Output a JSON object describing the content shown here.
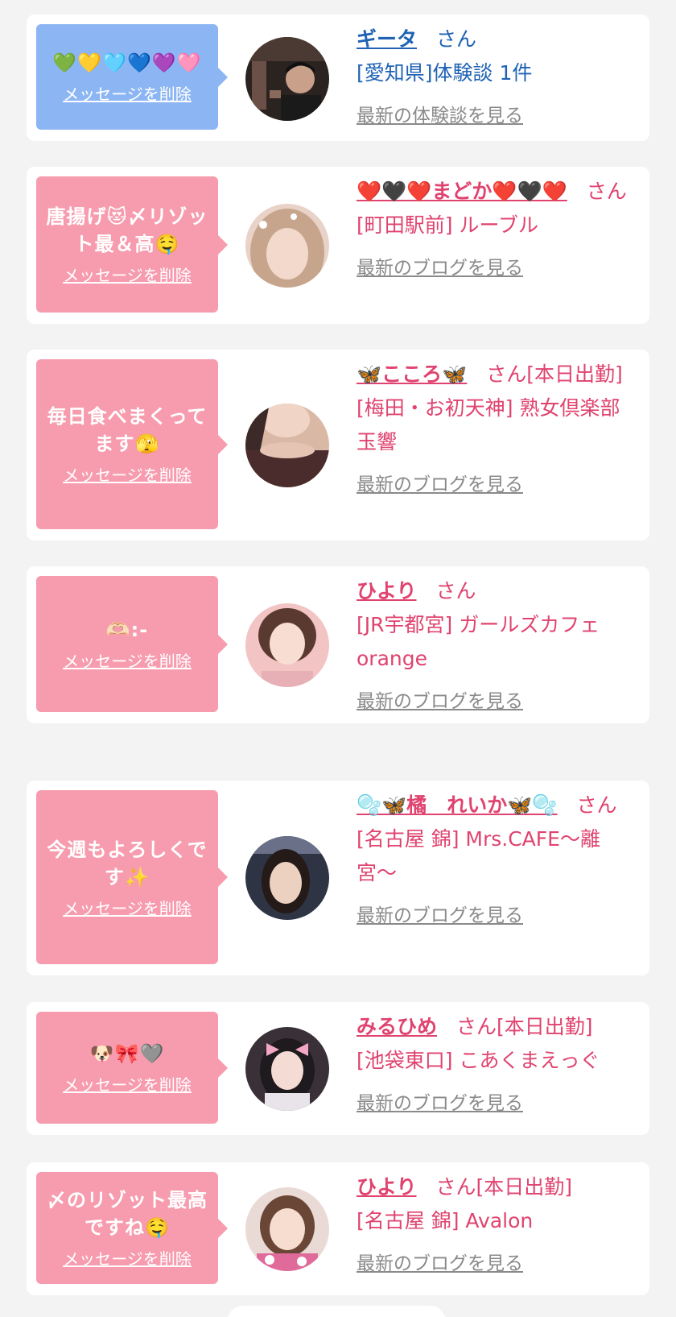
{
  "delete_label": "メッセージを削除",
  "san_label": "さん",
  "cards": [
    {
      "message": "💚💛🩵💙💜🩷",
      "name": "ギータ",
      "status": "",
      "shop": "[愛知県]体験談 1件",
      "latest_link": "最新の体験談を見る",
      "bubble_color": "#8cb6f3",
      "avatar_icon": "man-photo"
    },
    {
      "message": "唐揚げ😻〆リゾット最＆高🤤",
      "name": "❤️🖤❤️まどか❤️🖤❤️",
      "status": "",
      "shop": "[町田駅前] ルーブル",
      "latest_link": "最新のブログを見る",
      "bubble_color": "#f79cae",
      "avatar_icon": "woman-photo"
    },
    {
      "message": "毎日食べまくってます🫣",
      "name": "🦋こころ🦋",
      "status": "[本日出勤]",
      "shop": "[梅田・お初天神] 熟女倶楽部 玉響",
      "latest_link": "最新のブログを見る",
      "bubble_color": "#f79cae",
      "avatar_icon": "woman-photo"
    },
    {
      "message": "🫶🏻:-",
      "name": "ひより",
      "status": "",
      "shop": "[JR宇都宮] ガールズカフェorange",
      "latest_link": "最新のブログを見る",
      "bubble_color": "#f79cae",
      "avatar_icon": "woman-photo"
    },
    {
      "message": "今週もよろしくです✨",
      "name": "🫧🦋橘　れいか🦋🫧",
      "status": "",
      "shop": "[名古屋 錦] Mrs.CAFE〜離宮〜",
      "latest_link": "最新のブログを見る",
      "bubble_color": "#f79cae",
      "avatar_icon": "woman-photo"
    },
    {
      "message": "🐶🎀🩶",
      "name": "みるひめ",
      "status": "[本日出勤]",
      "shop": "[池袋東口] こあくまえっぐ",
      "latest_link": "最新のブログを見る",
      "bubble_color": "#f79cae",
      "avatar_icon": "woman-photo"
    },
    {
      "message": "〆のリゾット最高ですね🤤",
      "name": "ひより",
      "status": "[本日出勤]",
      "shop": "[名古屋 錦] Avalon",
      "latest_link": "最新のブログを見る",
      "bubble_color": "#f79cae",
      "avatar_icon": "woman-photo"
    }
  ]
}
